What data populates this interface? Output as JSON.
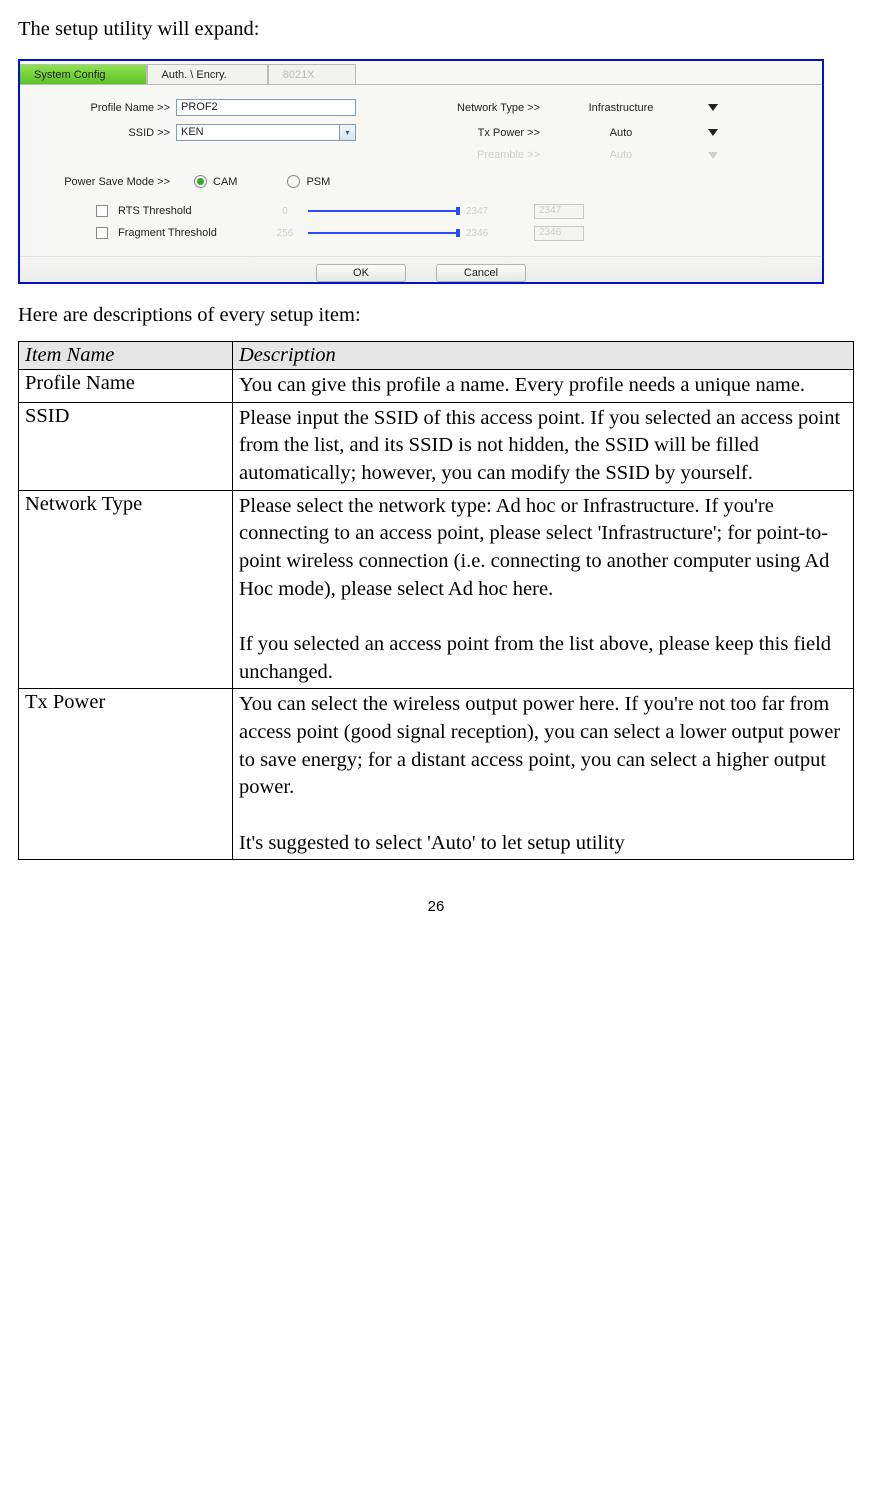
{
  "intro1": "The setup utility will expand:",
  "intro2": "Here are descriptions of every setup item:",
  "page_number": "26",
  "shot": {
    "tabs": {
      "active": "System Config",
      "t1": "Auth. \\ Encry.",
      "t2": "8021X"
    },
    "labels": {
      "profile": "Profile Name >>",
      "ssid": "SSID >>",
      "network": "Network Type >>",
      "txpower": "Tx Power >>",
      "preamble": "Preamble >>",
      "psm": "Power Save Mode >>",
      "rts": "RTS Threshold",
      "frag": "Fragment Threshold"
    },
    "values": {
      "profile": "PROF2",
      "ssid": "KEN",
      "network": "Infrastructure",
      "txpower": "Auto",
      "preamble": "Auto",
      "cam": "CAM",
      "psm": "PSM",
      "rts_min": "0",
      "rts_max": "2347",
      "rts_val": "2347",
      "frag_min": "256",
      "frag_max": "2346",
      "frag_val": "2346"
    },
    "buttons": {
      "ok": "OK",
      "cancel": "Cancel"
    }
  },
  "table": {
    "h0": "Item Name",
    "h1": "Description",
    "rows": [
      {
        "name": "Profile Name",
        "desc": [
          "You can give this profile a name. Every profile needs a unique name."
        ]
      },
      {
        "name": "SSID",
        "desc": [
          "Please input the SSID of this access point. If you selected an access point from the list, and its SSID is not hidden, the SSID will be filled automatically; however, you can modify the SSID by yourself."
        ]
      },
      {
        "name": "Network Type",
        "desc": [
          "Please select the network type: Ad hoc or Infrastructure. If you're connecting to an access point, please select 'Infrastructure'; for point-to-point wireless connection (i.e. connecting to another computer using Ad Hoc mode), please select Ad hoc here.",
          "If you selected an access point from the list above, please keep this field unchanged."
        ]
      },
      {
        "name": "Tx Power",
        "desc": [
          "You can select the wireless output power here. If you're not too far from access point (good signal reception), you can select a lower output power to save energy; for a distant access point, you can select a higher output power.",
          "It's suggested to select 'Auto' to let setup utility"
        ]
      }
    ]
  }
}
